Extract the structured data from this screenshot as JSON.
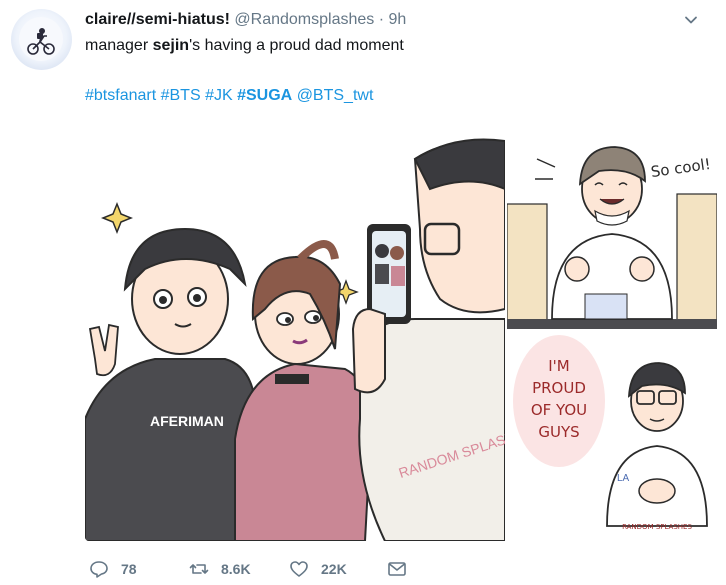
{
  "tweet": {
    "display_name": "claire//semi-hiatus!",
    "handle": "@Randomsplashes",
    "separator": "·",
    "time": "9h",
    "text": {
      "part1": "manager ",
      "bold1": "sejin",
      "part2": "'s having a proud dad moment"
    },
    "hashtags": [
      "#btsfanart",
      "#BTS",
      "#JK",
      "#SUGA"
    ],
    "mention": "@BTS_twt",
    "media": {
      "main_shirt_text": "AFERIMAN",
      "watermark_main": "RANDOM SPLASHES",
      "panel_top_speech": "So cool!",
      "panel_bottom_speech": [
        "I'M",
        "PROUD",
        "OF YOU",
        "GUYS"
      ],
      "watermark_small": "RANDOM SPLASHES",
      "badge_text": "LA"
    },
    "actions": {
      "replies": "78",
      "retweets": "8.6K",
      "likes": "22K"
    }
  },
  "icons": {
    "avatar": "bicycle-moon-avatar",
    "caret": "chevron-down-icon",
    "reply": "reply-icon",
    "retweet": "retweet-icon",
    "like": "heart-icon",
    "dm": "envelope-icon"
  },
  "colors": {
    "link": "#1b95e0",
    "muted": "#657786",
    "text": "#14171a"
  }
}
